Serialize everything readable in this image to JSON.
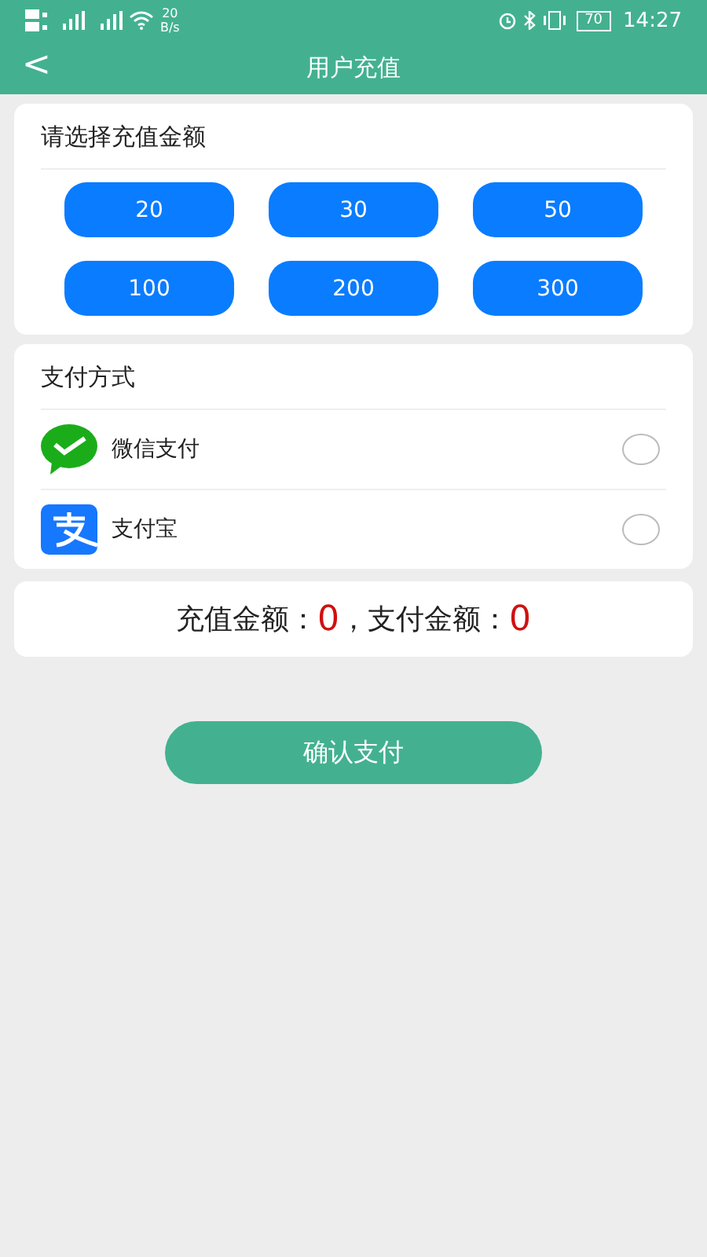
{
  "status_bar": {
    "speed_value": "20",
    "speed_unit": "B/s",
    "battery": "70",
    "time": "14:27"
  },
  "header": {
    "back": "<",
    "title": "用户充值"
  },
  "amount_card": {
    "title": "请选择充值金额",
    "amounts": [
      {
        "label": "20",
        "selected": false
      },
      {
        "label": "30",
        "selected": false
      },
      {
        "label": "50",
        "selected": false
      },
      {
        "label": "100",
        "selected": false
      },
      {
        "label": "200",
        "selected": false
      },
      {
        "label": "300",
        "selected": false
      }
    ]
  },
  "payment_card": {
    "title": "支付方式",
    "methods": [
      {
        "kind": "wechat",
        "label": "微信支付",
        "selected": false
      },
      {
        "kind": "alipay",
        "label": "支付宝",
        "selected": false
      }
    ]
  },
  "summary": {
    "recharge_label": "充值金额：",
    "recharge_value": "0",
    "pay_label": "，支付金额：",
    "pay_value": "0"
  },
  "confirm_button": "确认支付"
}
